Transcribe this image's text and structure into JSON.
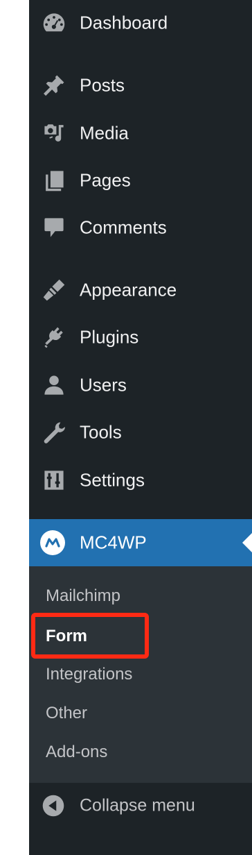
{
  "menu": {
    "dashboard": {
      "label": "Dashboard",
      "icon": "dashboard-icon"
    },
    "posts": {
      "label": "Posts",
      "icon": "pin-icon"
    },
    "media": {
      "label": "Media",
      "icon": "media-icon"
    },
    "pages": {
      "label": "Pages",
      "icon": "pages-icon"
    },
    "comments": {
      "label": "Comments",
      "icon": "comment-icon"
    },
    "appearance": {
      "label": "Appearance",
      "icon": "brush-icon"
    },
    "plugins": {
      "label": "Plugins",
      "icon": "plug-icon"
    },
    "users": {
      "label": "Users",
      "icon": "user-icon"
    },
    "tools": {
      "label": "Tools",
      "icon": "wrench-icon"
    },
    "settings": {
      "label": "Settings",
      "icon": "sliders-icon"
    },
    "mc4wp": {
      "label": "MC4WP",
      "icon": "mc4wp-logo-icon"
    }
  },
  "submenu": {
    "items": [
      "Mailchimp",
      "Form",
      "Integrations",
      "Other",
      "Add-ons"
    ],
    "current": "Form"
  },
  "collapse": {
    "label": "Collapse menu",
    "icon": "collapse-arrow-icon"
  },
  "colors": {
    "sidebar_bg": "#1d2327",
    "submenu_bg": "#2c3338",
    "active_bg": "#2271b1",
    "highlight": "#ff2a14"
  }
}
